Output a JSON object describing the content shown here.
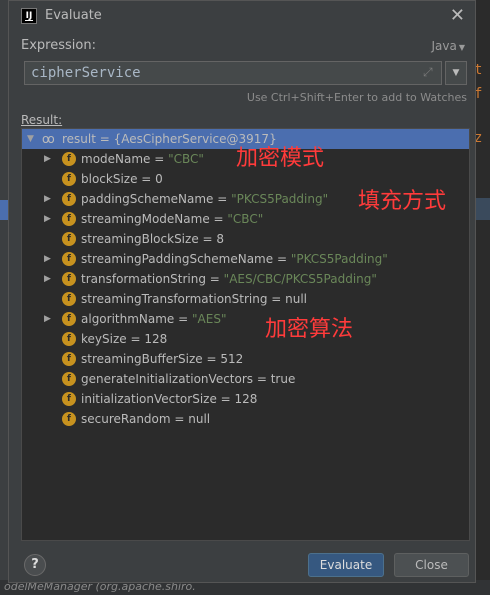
{
  "dialog": {
    "title": "Evaluate",
    "app_icon_text": "IJ",
    "close_glyph": "✕"
  },
  "expression": {
    "label": "Expression:",
    "language": "Java",
    "value": "cipherService",
    "hint": "Use Ctrl+Shift+Enter to add to Watches"
  },
  "result": {
    "label": "Result:",
    "root": {
      "name": "result",
      "value": "{AesCipherService@3917}"
    },
    "fields": [
      {
        "name": "modeName",
        "value": "\"CBC\"",
        "kind": "str",
        "expandable": true
      },
      {
        "name": "blockSize",
        "value": "0",
        "kind": "num",
        "expandable": false
      },
      {
        "name": "paddingSchemeName",
        "value": "\"PKCS5Padding\"",
        "kind": "str",
        "expandable": true
      },
      {
        "name": "streamingModeName",
        "value": "\"CBC\"",
        "kind": "str",
        "expandable": true
      },
      {
        "name": "streamingBlockSize",
        "value": "8",
        "kind": "num",
        "expandable": false
      },
      {
        "name": "streamingPaddingSchemeName",
        "value": "\"PKCS5Padding\"",
        "kind": "str",
        "expandable": true
      },
      {
        "name": "transformationString",
        "value": "\"AES/CBC/PKCS5Padding\"",
        "kind": "str",
        "expandable": true
      },
      {
        "name": "streamingTransformationString",
        "value": "null",
        "kind": "num",
        "expandable": false
      },
      {
        "name": "algorithmName",
        "value": "\"AES\"",
        "kind": "str",
        "expandable": true
      },
      {
        "name": "keySize",
        "value": "128",
        "kind": "num",
        "expandable": false
      },
      {
        "name": "streamingBufferSize",
        "value": "512",
        "kind": "num",
        "expandable": false
      },
      {
        "name": "generateInitializationVectors",
        "value": "true",
        "kind": "num",
        "expandable": false
      },
      {
        "name": "initializationVectorSize",
        "value": "128",
        "kind": "num",
        "expandable": false
      },
      {
        "name": "secureRandom",
        "value": "null",
        "kind": "num",
        "expandable": false
      }
    ]
  },
  "annotations": [
    {
      "text": "加密模式"
    },
    {
      "text": "填充方式"
    },
    {
      "text": "加密算法"
    }
  ],
  "buttons": {
    "help": "?",
    "evaluate": "Evaluate",
    "close": "Close"
  },
  "background": {
    "right_fragments": [
      "t",
      "f",
      "z"
    ],
    "bottom_text": "odelMeManager (org.apache.shiro."
  },
  "colors": {
    "string_value": "#6a8759",
    "field_badge": "#c7921f",
    "selected_row": "#4b6eaf",
    "annotation": "#ff3b3b",
    "evaluate_button": "#365880"
  }
}
